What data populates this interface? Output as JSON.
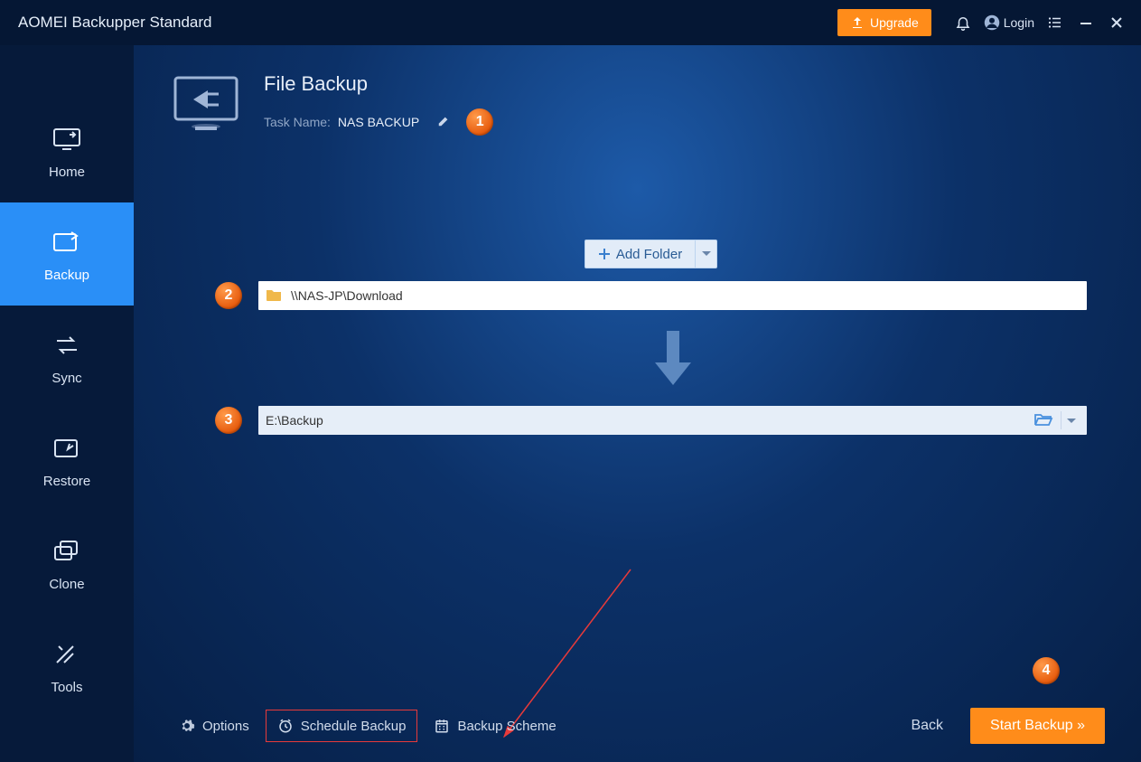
{
  "titlebar": {
    "app_title": "AOMEI Backupper Standard",
    "upgrade_label": "Upgrade",
    "login_label": "Login"
  },
  "sidebar": {
    "items": [
      {
        "label": "Home"
      },
      {
        "label": "Backup"
      },
      {
        "label": "Sync"
      },
      {
        "label": "Restore"
      },
      {
        "label": "Clone"
      },
      {
        "label": "Tools"
      }
    ]
  },
  "page": {
    "title": "File Backup",
    "task_label": "Task Name:",
    "task_name": "NAS BACKUP",
    "add_folder_label": "Add Folder",
    "source_path": "\\\\NAS-JP\\Download",
    "dest_path": "E:\\Backup"
  },
  "footer": {
    "options_label": "Options",
    "schedule_label": "Schedule Backup",
    "scheme_label": "Backup Scheme",
    "back_label": "Back",
    "start_label": "Start Backup »"
  },
  "callouts": {
    "c1": "1",
    "c2": "2",
    "c3": "3",
    "c4": "4"
  }
}
